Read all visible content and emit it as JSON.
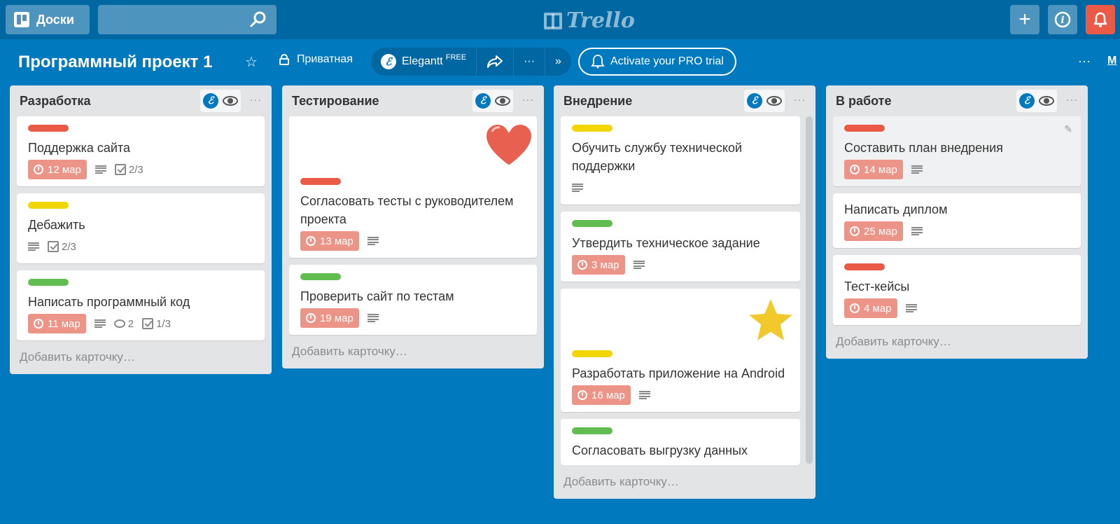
{
  "topbar": {
    "boards_label": "Доски",
    "search_placeholder": "",
    "logo_text": "Trello"
  },
  "boardbar": {
    "title": "Программный проект 1",
    "visibility": "Приватная",
    "elegantt_label": "Elegantt",
    "elegantt_tier": "FREE",
    "more_label": "···",
    "pro_trial_label": "Activate your PRO trial",
    "menu_label": "M"
  },
  "colors": {
    "red": "#eb5a46",
    "yellow": "#f2d600",
    "green": "#61bd4f",
    "due": "#ec9488",
    "board_bg": "#0079bf"
  },
  "lists": [
    {
      "title": "Разработка",
      "add_card": "Добавить карточку…",
      "cards": [
        {
          "label": "red",
          "title": "Поддержка сайта",
          "due": "12 мар",
          "desc": true,
          "checklist": "2/3"
        },
        {
          "label": "yellow",
          "title": "Дебажить",
          "desc": true,
          "checklist": "2/3"
        },
        {
          "label": "green",
          "title": "Написать программный код",
          "due": "11 мар",
          "desc": true,
          "comments": "2",
          "checklist": "1/3"
        }
      ]
    },
    {
      "title": "Тестирование",
      "add_card": "Добавить карточку…",
      "cards": [
        {
          "sticker": "heart",
          "label": "red",
          "title": "Согласовать тесты с руководителем проекта",
          "due": "13 мар",
          "desc": true
        },
        {
          "label": "green",
          "title": "Проверить сайт по тестам",
          "due": "19 мар",
          "desc": true
        }
      ]
    },
    {
      "title": "Внедрение",
      "add_card": "Добавить карточку…",
      "cards": [
        {
          "label": "yellow",
          "title": "Обучить службу технической поддержки",
          "desc": true
        },
        {
          "label": "green",
          "title": "Утвердить техническое задание",
          "due": "3 мар",
          "desc": true
        },
        {
          "sticker": "star",
          "label": "yellow",
          "title": "Разработать приложение на Android",
          "due": "16 мар",
          "desc": true
        },
        {
          "label": "green",
          "title": "Согласовать выгрузку данных"
        }
      ]
    },
    {
      "title": "В работе",
      "add_card": "Добавить карточку…",
      "cards": [
        {
          "label": "red",
          "title": "Составить план внедрения",
          "due": "14 мар",
          "desc": true,
          "hover": true
        },
        {
          "title": "Написать диплом",
          "due": "25 мар",
          "desc": true
        },
        {
          "label": "red",
          "title": "Тест-кейсы",
          "due": "4 мар",
          "desc": true
        }
      ]
    }
  ]
}
